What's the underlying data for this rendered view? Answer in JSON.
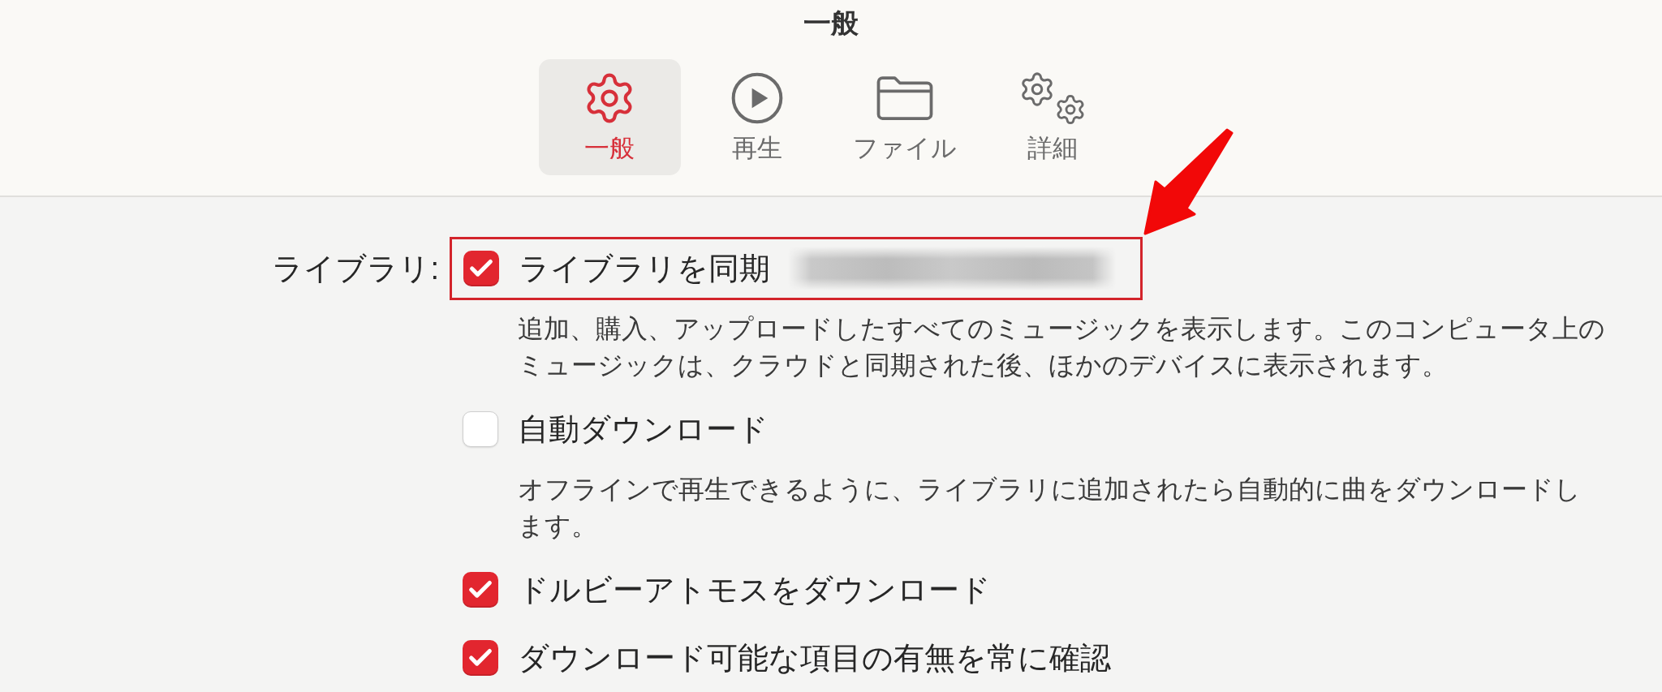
{
  "window": {
    "title": "一般"
  },
  "tabs": [
    {
      "label": "一般",
      "selected": true
    },
    {
      "label": "再生",
      "selected": false
    },
    {
      "label": "ファイル",
      "selected": false
    },
    {
      "label": "詳細",
      "selected": false
    }
  ],
  "library": {
    "label": "ライブラリ:",
    "options": [
      {
        "label": "ライブラリを同期",
        "checked": true,
        "highlighted": true,
        "redacted_detail": true,
        "description": "追加、購入、アップロードしたすべてのミュージックを表示します。このコンピュータ上のミュージックは、クラウドと同期された後、ほかのデバイスに表示されます。"
      },
      {
        "label": "自動ダウンロード",
        "checked": false,
        "highlighted": false,
        "redacted_detail": false,
        "description": "オフラインで再生できるように、ライブラリに追加されたら自動的に曲をダウンロードします。"
      },
      {
        "label": "ドルビーアトモスをダウンロード",
        "checked": true,
        "highlighted": false,
        "redacted_detail": false
      },
      {
        "label": "ダウンロード可能な項目の有無を常に確認",
        "checked": true,
        "highlighted": false,
        "redacted_detail": false
      }
    ]
  }
}
